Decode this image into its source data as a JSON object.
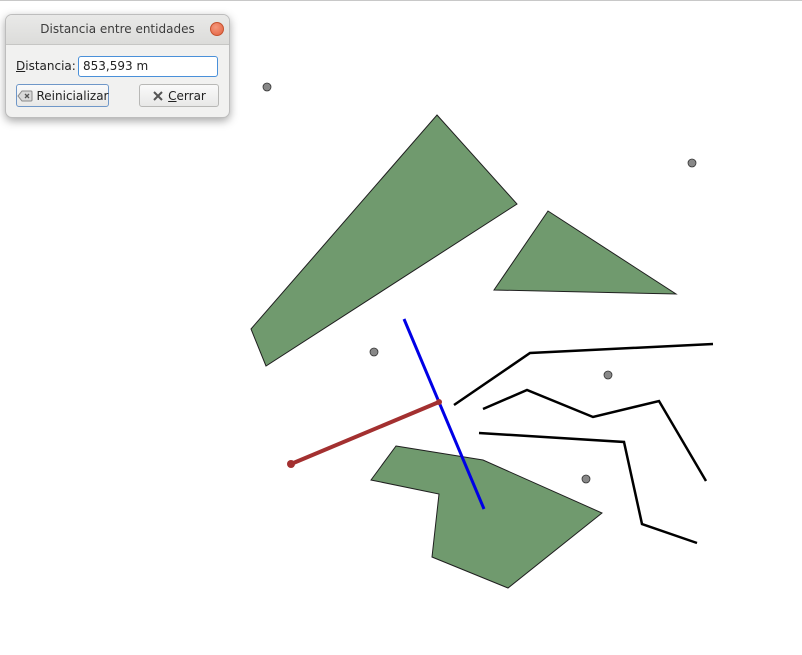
{
  "dialog": {
    "title": "Distancia entre entidades",
    "distance_label": "Distancia:",
    "distance_value": "853,593 m",
    "reset_label": "Reinicializar",
    "close_label": "Cerrar",
    "close_icon": "close-circle-icon",
    "reset_icon": "clear-icon",
    "cancel_icon": "x-icon"
  },
  "map": {
    "polygon_fill": "#709a6e",
    "polygon_stroke": "#1f1f1f",
    "line_color": "#000000",
    "point_color": "#888888",
    "measure_line_color": "#a33030",
    "selected_line_color": "#0000e6",
    "polygons": [
      {
        "name": "polygon-triangle-large"
      },
      {
        "name": "polygon-triangle-small"
      },
      {
        "name": "polygon-bottom"
      }
    ],
    "lines": [
      {
        "name": "line-upper"
      },
      {
        "name": "line-middle"
      },
      {
        "name": "line-lower"
      }
    ],
    "points": [
      {
        "name": "point-1"
      },
      {
        "name": "point-2"
      },
      {
        "name": "point-3"
      },
      {
        "name": "point-4"
      },
      {
        "name": "point-5"
      }
    ]
  }
}
